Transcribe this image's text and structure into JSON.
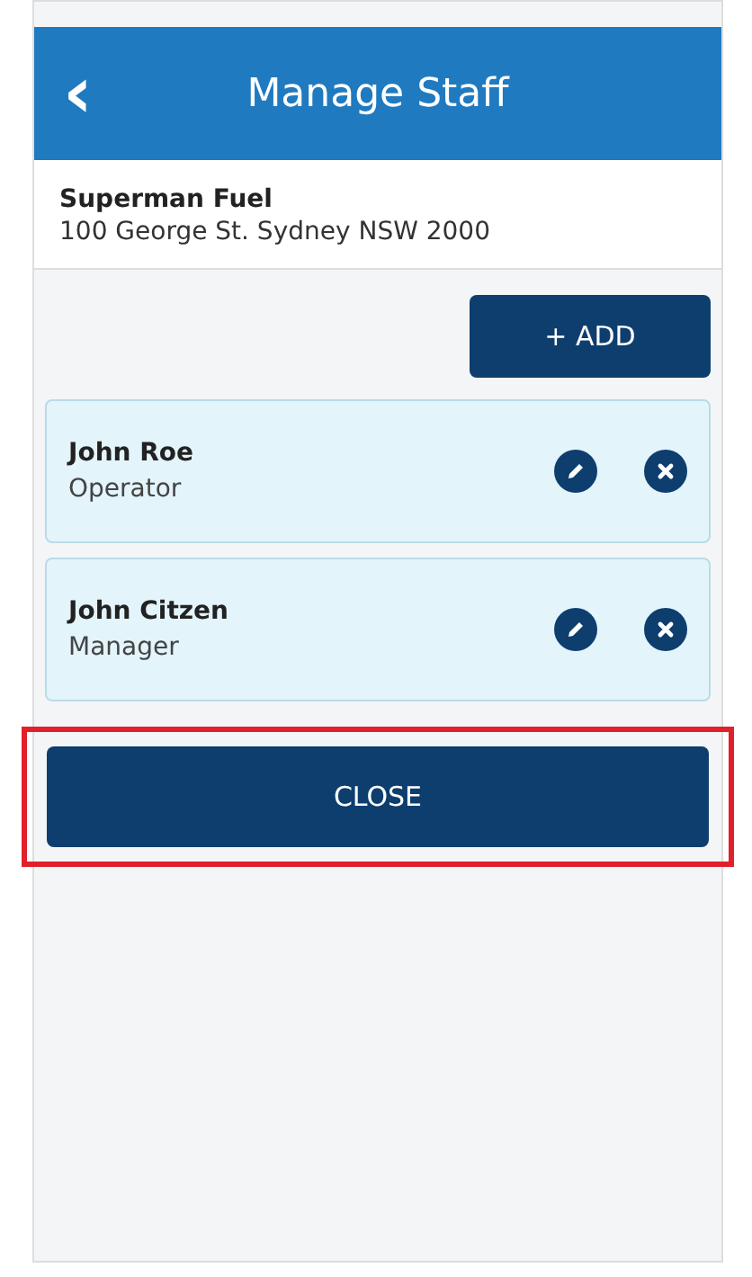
{
  "header": {
    "title": "Manage Staff",
    "back": "‹"
  },
  "business": {
    "name": "Superman Fuel",
    "address": "100 George St. Sydney NSW 2000"
  },
  "add_button": "+ ADD",
  "staff": [
    {
      "name": "John Roe",
      "role": "Operator"
    },
    {
      "name": "John Citzen",
      "role": "Manager"
    }
  ],
  "close_button": {
    "label": "CLOSE",
    "highlighted": true
  }
}
